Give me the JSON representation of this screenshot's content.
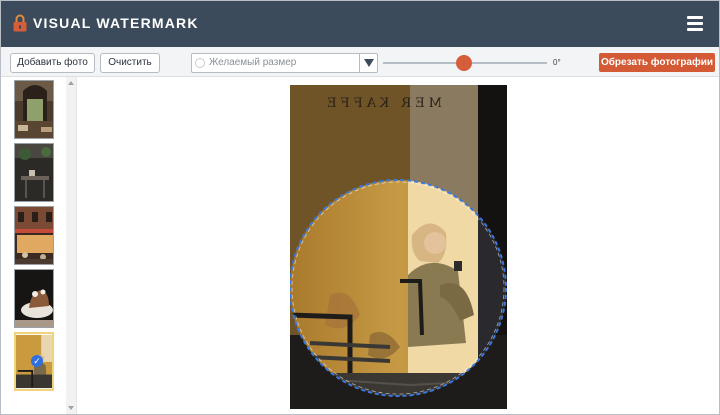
{
  "header": {
    "title": "VISUAL WATERMARK",
    "bg_color": "#3c4b5c"
  },
  "toolbar": {
    "add_photo_label": "Добавить фото",
    "clear_label": "Очистить",
    "size_placeholder": "Желаемый размер",
    "angle_value": "0°",
    "crop_label": "Обрезать фотографии",
    "accent_color": "#d35a35"
  },
  "sidebar": {
    "thumbnails": [
      {
        "name": "restaurant-interior",
        "selected": false
      },
      {
        "name": "cafe-table",
        "selected": false
      },
      {
        "name": "street-storefront",
        "selected": false
      },
      {
        "name": "dessert-plate",
        "selected": false
      },
      {
        "name": "woman-in-cafe",
        "selected": true
      }
    ]
  },
  "canvas": {
    "crop_shape": "circle",
    "wall_text": "MER KAFFE"
  }
}
